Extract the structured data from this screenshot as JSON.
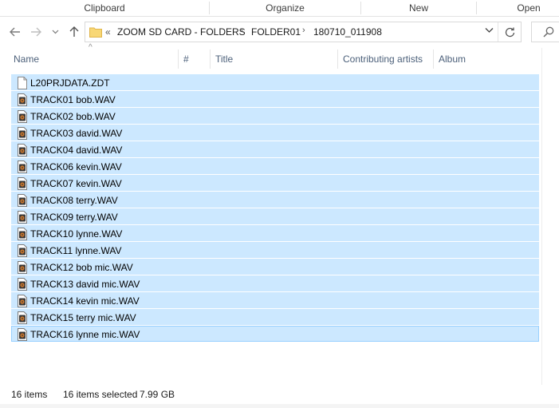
{
  "ribbon": {
    "groups": [
      {
        "label": "Clipboard"
      },
      {
        "label": "Organize"
      },
      {
        "label": "New"
      },
      {
        "label": "Open"
      }
    ]
  },
  "address": {
    "overflow": "«",
    "crumbs": [
      "ZOOM SD CARD - FOLDERS",
      "FOLDER01",
      "180710_011908"
    ]
  },
  "columns": {
    "name": "Name",
    "number": "#",
    "title": "Title",
    "artists": "Contributing artists",
    "album": "Album"
  },
  "files": [
    {
      "name": "L20PRJDATA.ZDT",
      "icon": "generic-file-icon"
    },
    {
      "name": "TRACK01 bob.WAV",
      "icon": "audio-file-icon"
    },
    {
      "name": "TRACK02 bob.WAV",
      "icon": "audio-file-icon"
    },
    {
      "name": "TRACK03 david.WAV",
      "icon": "audio-file-icon"
    },
    {
      "name": "TRACK04 david.WAV",
      "icon": "audio-file-icon"
    },
    {
      "name": "TRACK06 kevin.WAV",
      "icon": "audio-file-icon"
    },
    {
      "name": "TRACK07 kevin.WAV",
      "icon": "audio-file-icon"
    },
    {
      "name": "TRACK08 terry.WAV",
      "icon": "audio-file-icon"
    },
    {
      "name": "TRACK09 terry.WAV",
      "icon": "audio-file-icon"
    },
    {
      "name": "TRACK10 lynne.WAV",
      "icon": "audio-file-icon"
    },
    {
      "name": "TRACK11 lynne.WAV",
      "icon": "audio-file-icon"
    },
    {
      "name": "TRACK12 bob mic.WAV",
      "icon": "audio-file-icon"
    },
    {
      "name": "TRACK13 david mic.WAV",
      "icon": "audio-file-icon"
    },
    {
      "name": "TRACK14 kevin mic.WAV",
      "icon": "audio-file-icon"
    },
    {
      "name": "TRACK15 terry mic.WAV",
      "icon": "audio-file-icon"
    },
    {
      "name": "TRACK16 lynne mic.WAV",
      "icon": "audio-file-icon"
    }
  ],
  "status": {
    "item_count": "16 items",
    "selected": "16 items selected",
    "size": "7.99 GB"
  },
  "colors": {
    "selection": "#cce8ff",
    "focus_border": "#99d1ff",
    "header_text": "#4c607a"
  }
}
